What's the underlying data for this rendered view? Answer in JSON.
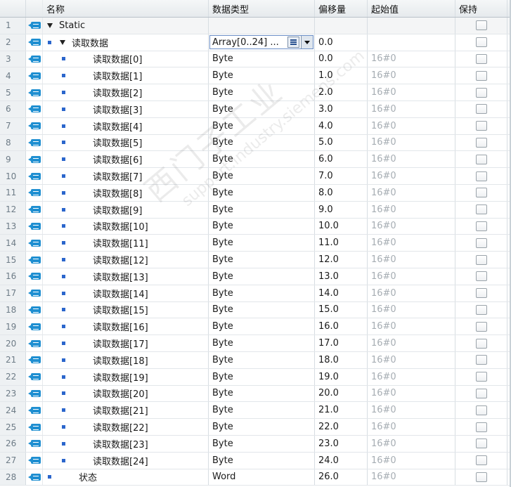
{
  "header": {
    "col_name": "名称",
    "col_type": "数据类型",
    "col_offset": "偏移量",
    "col_start": "起始值",
    "col_retain": "保持",
    "col_extra": "..."
  },
  "rows": [
    {
      "num": "1",
      "name": "Static",
      "type": "",
      "offset": "",
      "start": "",
      "kind": "section"
    },
    {
      "num": "2",
      "name": "读取数据",
      "type": "Array[0..24] ...",
      "offset": "0.0",
      "start": "",
      "kind": "array"
    },
    {
      "num": "3",
      "name": "读取数据[0]",
      "type": "Byte",
      "offset": "0.0",
      "start": "16#0",
      "kind": "element"
    },
    {
      "num": "4",
      "name": "读取数据[1]",
      "type": "Byte",
      "offset": "1.0",
      "start": "16#0",
      "kind": "element"
    },
    {
      "num": "5",
      "name": "读取数据[2]",
      "type": "Byte",
      "offset": "2.0",
      "start": "16#0",
      "kind": "element"
    },
    {
      "num": "6",
      "name": "读取数据[3]",
      "type": "Byte",
      "offset": "3.0",
      "start": "16#0",
      "kind": "element"
    },
    {
      "num": "7",
      "name": "读取数据[4]",
      "type": "Byte",
      "offset": "4.0",
      "start": "16#0",
      "kind": "element"
    },
    {
      "num": "8",
      "name": "读取数据[5]",
      "type": "Byte",
      "offset": "5.0",
      "start": "16#0",
      "kind": "element"
    },
    {
      "num": "9",
      "name": "读取数据[6]",
      "type": "Byte",
      "offset": "6.0",
      "start": "16#0",
      "kind": "element"
    },
    {
      "num": "10",
      "name": "读取数据[7]",
      "type": "Byte",
      "offset": "7.0",
      "start": "16#0",
      "kind": "element"
    },
    {
      "num": "11",
      "name": "读取数据[8]",
      "type": "Byte",
      "offset": "8.0",
      "start": "16#0",
      "kind": "element"
    },
    {
      "num": "12",
      "name": "读取数据[9]",
      "type": "Byte",
      "offset": "9.0",
      "start": "16#0",
      "kind": "element"
    },
    {
      "num": "13",
      "name": "读取数据[10]",
      "type": "Byte",
      "offset": "10.0",
      "start": "16#0",
      "kind": "element"
    },
    {
      "num": "14",
      "name": "读取数据[11]",
      "type": "Byte",
      "offset": "11.0",
      "start": "16#0",
      "kind": "element"
    },
    {
      "num": "15",
      "name": "读取数据[12]",
      "type": "Byte",
      "offset": "12.0",
      "start": "16#0",
      "kind": "element"
    },
    {
      "num": "16",
      "name": "读取数据[13]",
      "type": "Byte",
      "offset": "13.0",
      "start": "16#0",
      "kind": "element"
    },
    {
      "num": "17",
      "name": "读取数据[14]",
      "type": "Byte",
      "offset": "14.0",
      "start": "16#0",
      "kind": "element"
    },
    {
      "num": "18",
      "name": "读取数据[15]",
      "type": "Byte",
      "offset": "15.0",
      "start": "16#0",
      "kind": "element"
    },
    {
      "num": "19",
      "name": "读取数据[16]",
      "type": "Byte",
      "offset": "16.0",
      "start": "16#0",
      "kind": "element"
    },
    {
      "num": "20",
      "name": "读取数据[17]",
      "type": "Byte",
      "offset": "17.0",
      "start": "16#0",
      "kind": "element"
    },
    {
      "num": "21",
      "name": "读取数据[18]",
      "type": "Byte",
      "offset": "18.0",
      "start": "16#0",
      "kind": "element"
    },
    {
      "num": "22",
      "name": "读取数据[19]",
      "type": "Byte",
      "offset": "19.0",
      "start": "16#0",
      "kind": "element"
    },
    {
      "num": "23",
      "name": "读取数据[20]",
      "type": "Byte",
      "offset": "20.0",
      "start": "16#0",
      "kind": "element"
    },
    {
      "num": "24",
      "name": "读取数据[21]",
      "type": "Byte",
      "offset": "21.0",
      "start": "16#0",
      "kind": "element"
    },
    {
      "num": "25",
      "name": "读取数据[22]",
      "type": "Byte",
      "offset": "22.0",
      "start": "16#0",
      "kind": "element"
    },
    {
      "num": "26",
      "name": "读取数据[23]",
      "type": "Byte",
      "offset": "23.0",
      "start": "16#0",
      "kind": "element"
    },
    {
      "num": "27",
      "name": "读取数据[24]",
      "type": "Byte",
      "offset": "24.0",
      "start": "16#0",
      "kind": "element"
    },
    {
      "num": "28",
      "name": "状态",
      "type": "Word",
      "offset": "26.0",
      "start": "16#0",
      "kind": "plain"
    }
  ],
  "watermark": {
    "line1": "西门子工业",
    "line2": "support.industry.siemens.com"
  },
  "colors": {
    "icon_blue": "#1f8fd1",
    "dot_blue": "#2b66cc"
  }
}
